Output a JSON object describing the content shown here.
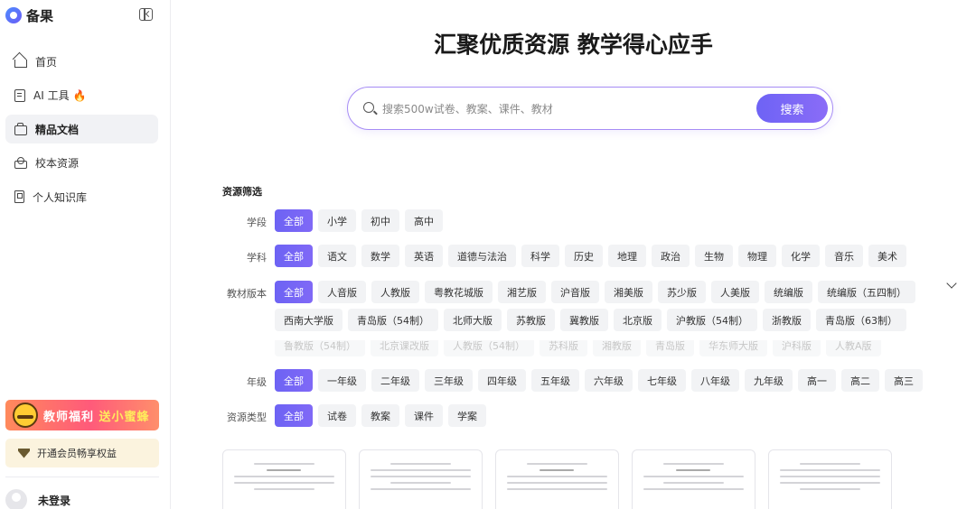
{
  "sidebar": {
    "brand": "备果",
    "nav": [
      {
        "label": "首页",
        "icon": "home-icon"
      },
      {
        "label": "AI 工具",
        "icon": "document-icon",
        "badge": "🔥"
      },
      {
        "label": "精品文档",
        "icon": "folder-icon",
        "active": true
      },
      {
        "label": "校本资源",
        "icon": "school-icon"
      },
      {
        "label": "个人知识库",
        "icon": "book-icon"
      }
    ],
    "promo": {
      "text_a": "教师福利",
      "text_b": "送小蜜蜂"
    },
    "vip_label": "开通会员畅享权益",
    "user_name": "未登录"
  },
  "hero": {
    "title": "汇聚优质资源 教学得心应手",
    "search_placeholder": "搜索500w试卷、教案、课件、教材",
    "search_button": "搜索"
  },
  "filters": {
    "title": "资源筛选",
    "stage": {
      "label": "学段",
      "options": [
        "全部",
        "小学",
        "初中",
        "高中"
      ]
    },
    "subject": {
      "label": "学科",
      "options": [
        "全部",
        "语文",
        "数学",
        "英语",
        "道德与法治",
        "科学",
        "历史",
        "地理",
        "政治",
        "生物",
        "物理",
        "化学",
        "音乐",
        "美术"
      ]
    },
    "edition": {
      "label": "教材版本",
      "options": [
        "全部",
        "人音版",
        "人教版",
        "粤教花城版",
        "湘艺版",
        "沪音版",
        "湘美版",
        "苏少版",
        "人美版",
        "统编版",
        "统编版（五四制）",
        "西南大学版",
        "青岛版（54制）",
        "北师大版",
        "苏教版",
        "冀教版",
        "北京版",
        "沪教版（54制）",
        "浙教版",
        "青岛版（63制）"
      ],
      "more": [
        "鲁教版（54制）",
        "北京课改版",
        "人教版（54制）",
        "苏科版",
        "湘教版",
        "青岛版",
        "华东师大版",
        "沪科版",
        "人教A版"
      ]
    },
    "grade": {
      "label": "年级",
      "options": [
        "全部",
        "一年级",
        "二年级",
        "三年级",
        "四年级",
        "五年级",
        "六年级",
        "七年级",
        "八年级",
        "九年级",
        "高一",
        "高二",
        "高三"
      ]
    },
    "type": {
      "label": "资源类型",
      "options": [
        "全部",
        "试卷",
        "教案",
        "课件",
        "学案"
      ]
    }
  }
}
